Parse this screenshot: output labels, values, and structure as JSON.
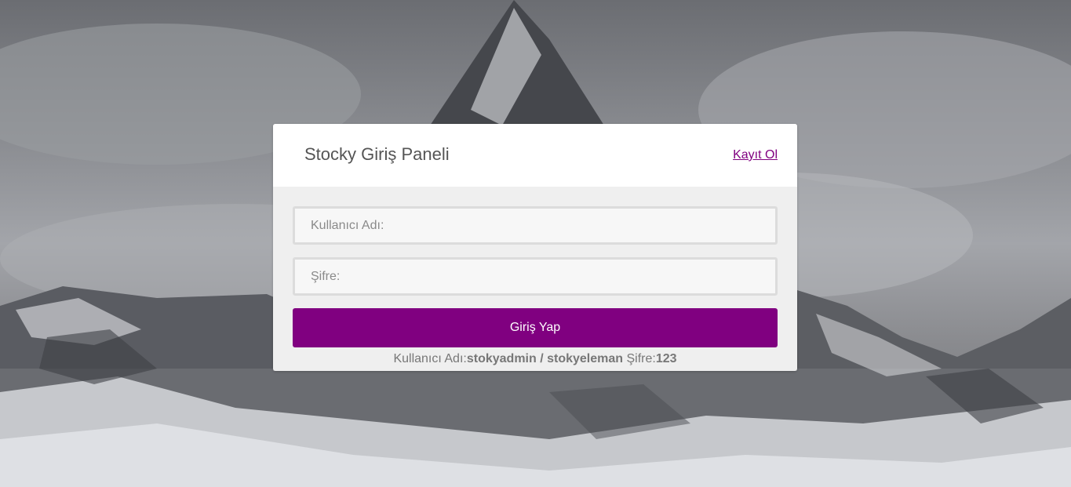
{
  "panel": {
    "title": "Stocky Giriş Paneli",
    "register_link": "Kayıt Ol"
  },
  "form": {
    "username_placeholder": "Kullanıcı Adı:",
    "password_placeholder": "Şifre:",
    "login_button": "Giriş Yap"
  },
  "hint": {
    "username_label": "Kullanıcı Adı:",
    "username_value": "stokyadmin / stokyeleman",
    "password_label": " Şifre:",
    "password_value": "123"
  },
  "colors": {
    "accent": "#800080",
    "panel_bg": "#efefef",
    "header_bg": "#ffffff"
  },
  "background_image": "snowy-mountain-peak"
}
